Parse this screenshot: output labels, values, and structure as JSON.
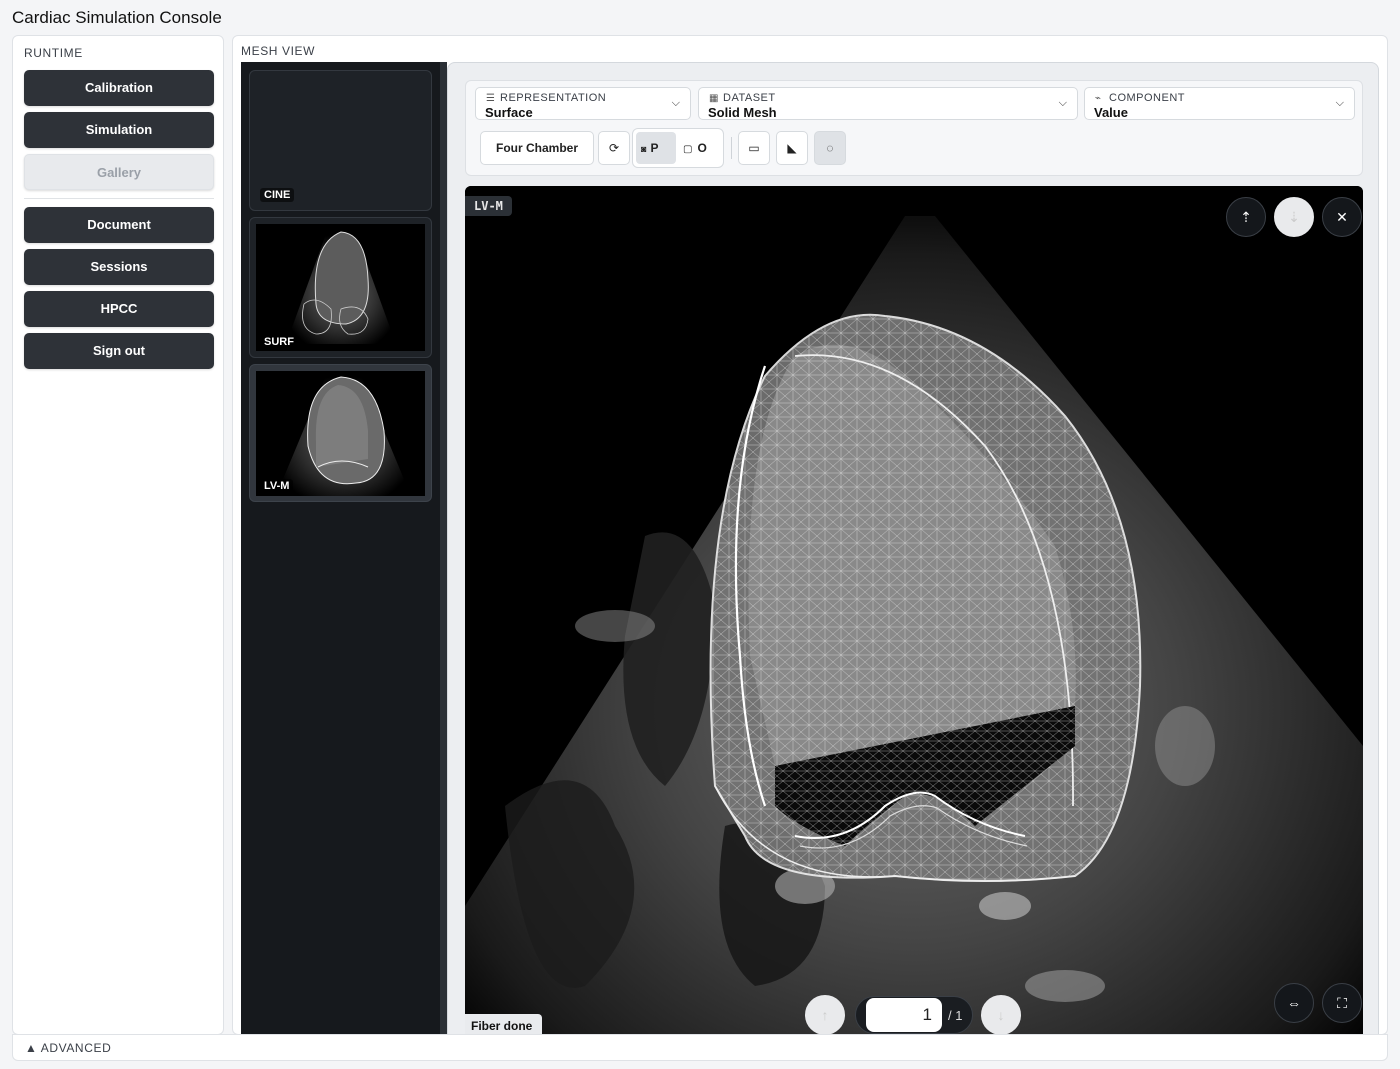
{
  "app": {
    "title": "Cardiac Simulation Console"
  },
  "sidebar": {
    "heading": "RUNTIME",
    "buttons": [
      {
        "label": "Calibration",
        "state": "enabled"
      },
      {
        "label": "Simulation",
        "state": "enabled"
      },
      {
        "label": "Gallery",
        "state": "disabled"
      },
      {
        "label": "Document",
        "state": "enabled"
      },
      {
        "label": "Sessions",
        "state": "enabled"
      },
      {
        "label": "HPCC",
        "state": "enabled"
      },
      {
        "label": "Sign out",
        "state": "enabled"
      }
    ]
  },
  "mesh_view": {
    "heading": "MESH VIEW",
    "thumbnails": [
      {
        "label": "CINE",
        "has_image": false
      },
      {
        "label": "SURF",
        "has_image": true
      },
      {
        "label": "LV-M",
        "has_image": true,
        "active": true
      }
    ]
  },
  "toolbar": {
    "representation": {
      "label": "REPRESENTATION",
      "value": "Surface",
      "icon": "list-icon"
    },
    "dataset": {
      "label": "DATASET",
      "value": "Solid Mesh",
      "icon": "table-icon"
    },
    "component": {
      "label": "COMPONENT",
      "value": "Value",
      "icon": "chart-icon"
    },
    "view_preset": "Four Chamber",
    "projection": {
      "perspective": "P",
      "orthographic": "O",
      "selected": "P"
    }
  },
  "viewer": {
    "tag": "LV-M",
    "page": {
      "current": "1",
      "total": "/ 1"
    },
    "status": "Fiber done"
  },
  "footer": {
    "advanced_label": "▲  ADVANCED"
  }
}
